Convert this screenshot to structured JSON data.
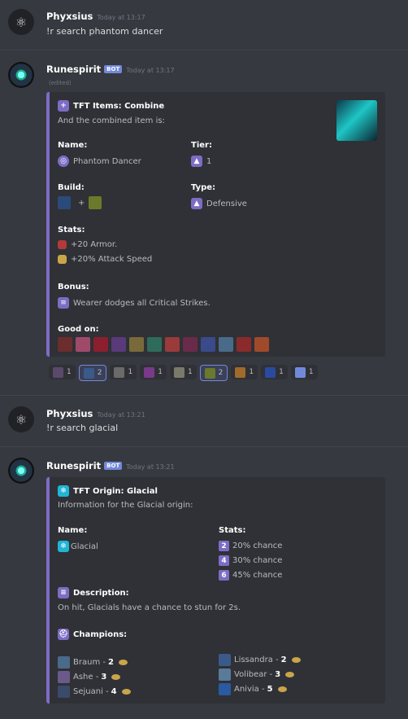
{
  "messages": [
    {
      "user": "Phyxsius",
      "time": "Today at 13:17",
      "text": "!r search phantom dancer"
    },
    {
      "user": "Runespirit",
      "bot_tag": "BOT",
      "time": "Today at 13:17",
      "edited": "(edited)"
    },
    {
      "user": "Phyxsius",
      "time": "Today at 13:21",
      "text": "!r search glacial"
    },
    {
      "user": "Runespirit",
      "bot_tag": "BOT",
      "time": "Today at 13:21"
    }
  ],
  "embed1": {
    "title": "TFT Items: Combine",
    "subtitle": "And the combined item is:",
    "name_label": "Name:",
    "name_value": "Phantom Dancer",
    "tier_label": "Tier:",
    "tier_value": "1",
    "build_label": "Build:",
    "build_plus": "+",
    "type_label": "Type:",
    "type_value": "Defensive",
    "stats_label": "Stats:",
    "stats": [
      "+20 Armor.",
      "+20% Attack Speed"
    ],
    "bonus_label": "Bonus:",
    "bonus_value": "Wearer dodges all Critical Strikes.",
    "goodon_label": "Good on:",
    "goodon_colors": [
      "#6b2d2d",
      "#a04a6a",
      "#8b1f2e",
      "#5a3a7a",
      "#7a6a3a",
      "#2f6b5a",
      "#9a3a3a",
      "#6a2a4a",
      "#3a4a8a",
      "#4a6a8a",
      "#8a2a2a",
      "#a04a2a"
    ]
  },
  "reactions": [
    {
      "count": "1",
      "color": "#5a4a6a",
      "active": false
    },
    {
      "count": "2",
      "color": "#3a5a8a",
      "active": true
    },
    {
      "count": "1",
      "color": "#6a6a6a",
      "active": false
    },
    {
      "count": "1",
      "color": "#7a3a8a",
      "active": false
    },
    {
      "count": "1",
      "color": "#7a7a6a",
      "active": false
    },
    {
      "count": "2",
      "color": "#6a7a2a",
      "active": true
    },
    {
      "count": "1",
      "color": "#a06a2a",
      "active": false
    },
    {
      "count": "1",
      "color": "#2a4aa0",
      "active": false
    },
    {
      "count": "1",
      "color": "#7289da",
      "active": false
    }
  ],
  "embed2": {
    "title": "TFT Origin: Glacial",
    "subtitle": "Information for the Glacial origin:",
    "name_label": "Name:",
    "name_value": "Glacial",
    "stats_label": "Stats:",
    "stats": [
      {
        "n": "2",
        "t": "20% chance"
      },
      {
        "n": "4",
        "t": "30% chance"
      },
      {
        "n": "6",
        "t": "45% chance"
      }
    ],
    "desc_label": "Description:",
    "desc_value": "On hit, Glacials have a chance to stun for 2s.",
    "champ_label": "Champions:",
    "champions_left": [
      {
        "name": "Braum - ",
        "cost": "2"
      },
      {
        "name": "Ashe - ",
        "cost": "3"
      },
      {
        "name": "Sejuani - ",
        "cost": "4"
      }
    ],
    "champions_right": [
      {
        "name": "Lissandra - ",
        "cost": "2"
      },
      {
        "name": "Volibear - ",
        "cost": "3"
      },
      {
        "name": "Anivia - ",
        "cost": "5"
      }
    ]
  }
}
